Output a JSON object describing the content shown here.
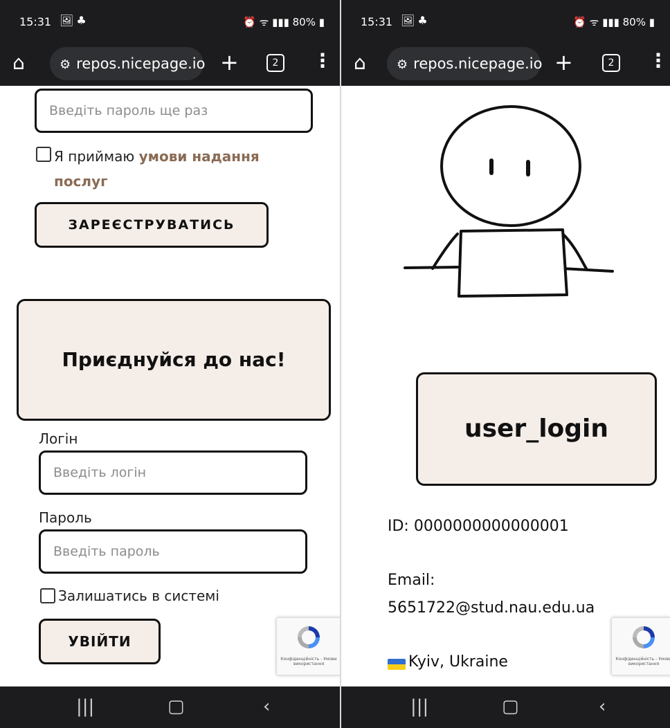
{
  "browser": {
    "time": "15:31",
    "battery": "80%",
    "url": "repos.nicepage.io",
    "tab_count": "2"
  },
  "register": {
    "password_repeat_placeholder": "Введіть пароль ще раз",
    "terms_prefix": "Я приймаю",
    "terms_link": "умови надання послуг",
    "register_button": "ЗАРЕЄСТРУВАТИСЬ"
  },
  "login": {
    "banner": "Приєднуйся до нас!",
    "login_label": "Логін",
    "login_placeholder": "Введіть логін",
    "password_label": "Пароль",
    "password_placeholder": "Введіть пароль",
    "remember_label": "Залишатись в системі",
    "login_button": "УВІЙТИ"
  },
  "recaptcha": {
    "text": "Конфіденційність - Умови використання"
  },
  "profile": {
    "username": "user_login",
    "id_line": "ID: 0000000000000001",
    "email_label": "Email:",
    "email_value": "5651722@stud.nau.edu.ua",
    "location": "Kyiv, Ukraine"
  },
  "colors": {
    "accent_brown": "#8a6b55",
    "card_bg": "#f4ede8",
    "chrome_dark": "#1c1c1e"
  }
}
